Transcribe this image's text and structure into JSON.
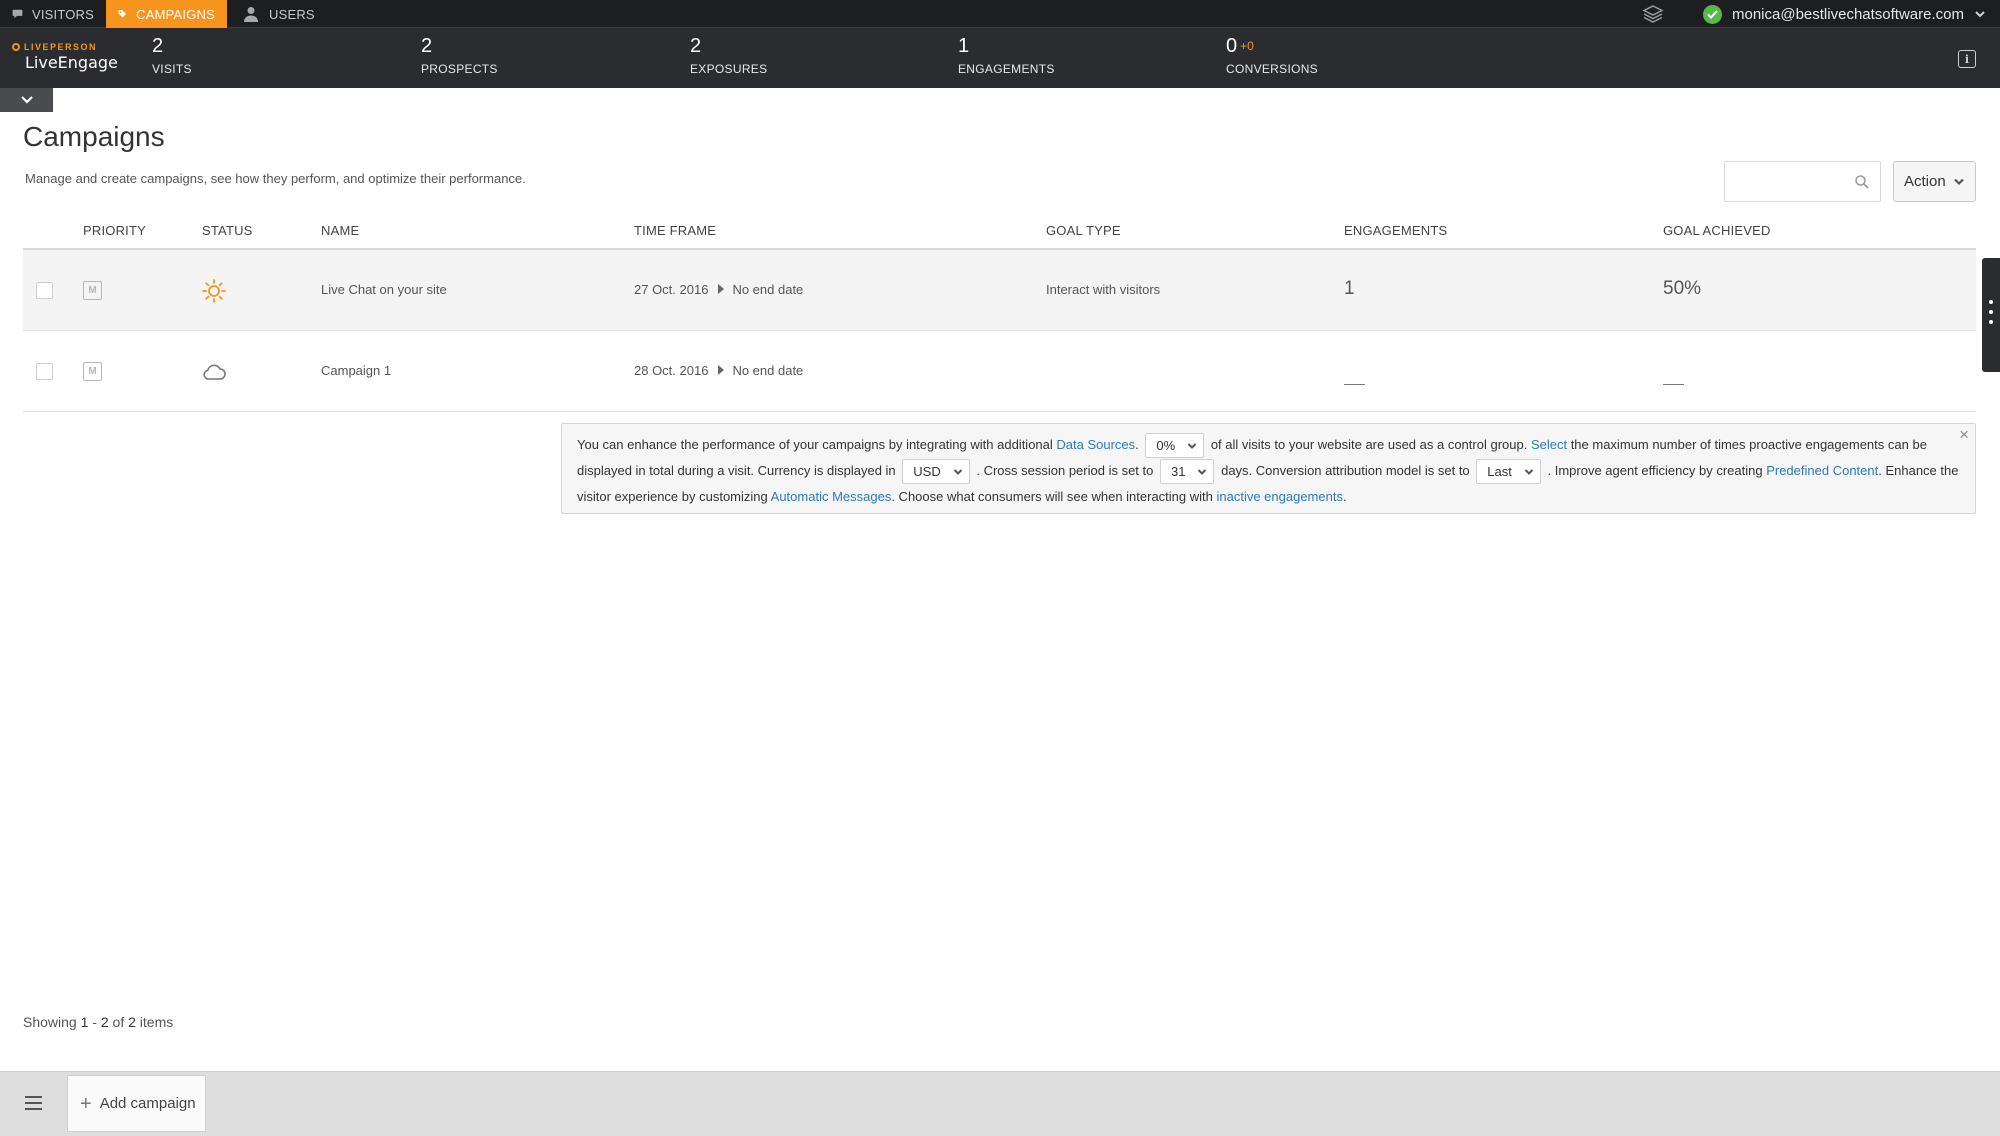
{
  "tabs": [
    {
      "label": "VISITORS"
    },
    {
      "label": "CAMPAIGNS"
    },
    {
      "label": "USERS"
    }
  ],
  "user": {
    "email": "monica@bestlivechatsoftware.com"
  },
  "brand": {
    "top": "LIVEPERSON",
    "name": "LiveEngage",
    "accent": "#f7941d"
  },
  "kpis": [
    {
      "value": "2",
      "label": "VISITS"
    },
    {
      "value": "2",
      "label": "PROSPECTS"
    },
    {
      "value": "2",
      "label": "EXPOSURES"
    },
    {
      "value": "1",
      "label": "ENGAGEMENTS"
    },
    {
      "value": "0",
      "delta": "+0",
      "label": "CONVERSIONS"
    }
  ],
  "page": {
    "title": "Campaigns",
    "description": "Manage and create campaigns, see how they perform, and optimize their performance.",
    "search_placeholder": "",
    "action_label": "Action"
  },
  "table": {
    "headers": [
      "PRIORITY",
      "STATUS",
      "NAME",
      "TIME FRAME",
      "GOAL TYPE",
      "ENGAGEMENTS",
      "GOAL ACHIEVED"
    ],
    "rows": [
      {
        "priority": "M",
        "status": "sun-icon",
        "name": "Live Chat on your site",
        "start": "27 Oct. 2016",
        "end": "No end date",
        "goal_type": "Interact with visitors",
        "engagements": "1",
        "goal_achieved": "50%"
      },
      {
        "priority": "M",
        "status": "cloud-icon",
        "name": "Campaign 1",
        "start": "28 Oct. 2016",
        "end": "No end date",
        "goal_type": "",
        "engagements": "—",
        "goal_achieved": "—"
      }
    ]
  },
  "info": {
    "t1": "You can enhance the performance of your campaigns by integrating with additional ",
    "link_data_sources": "Data Sources",
    "t2": ".",
    "control_group_value": "0%",
    "t3": " of all visits to your website are used as a control group. ",
    "link_select": "Select",
    "t4": " the maximum number of times proactive engagements can be displayed in total during a visit. Currency is displayed in ",
    "currency_value": "USD",
    "t5": ". Cross session period is set to ",
    "session_value": "31",
    "t6": " days. Conversion attribution model is set to ",
    "attribution_value": "Last",
    "t7": ". Improve agent efficiency by creating ",
    "link_predefined": "Predefined Content",
    "t8": ". Enhance the visitor experience by customizing ",
    "link_auto_messages": "Automatic Messages",
    "t9": ". Choose what consumers will see when interacting with ",
    "link_inactive": "inactive engagements",
    "t10": "."
  },
  "pagination": {
    "prefix": "Showing ",
    "from": "1",
    "sep": " - ",
    "to": "2",
    "of": " of ",
    "total": "2",
    "suffix": " items"
  },
  "footer": {
    "add_label": "Add campaign"
  }
}
